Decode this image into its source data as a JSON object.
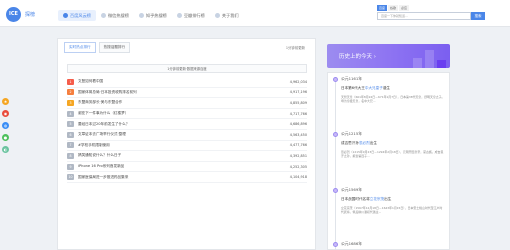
{
  "app": {
    "logo_text": "ICE",
    "title": "探榜"
  },
  "nav": [
    {
      "label": "百度风云榜",
      "active": true
    },
    {
      "label": "微信热搜榜",
      "active": false
    },
    {
      "label": "知乎热搜榜",
      "active": false
    },
    {
      "label": "豆瓣排行榜",
      "active": false
    },
    {
      "label": "关于我们",
      "active": false
    }
  ],
  "search": {
    "tabs": [
      "百度",
      "谷歌",
      "必应"
    ],
    "placeholder": "百度一下你就知道...",
    "button": "搜索"
  },
  "main": {
    "tabs": [
      {
        "label": "实时热点排行",
        "active": true
      },
      {
        "label": "热搜话题排行",
        "active": false
      }
    ],
    "updated": "1分钟前更新",
    "info": "1分钟前更新·数据来源百度",
    "rows": [
      {
        "rank": "1",
        "title": "文登如何看中国",
        "heat": "4,962,034",
        "color": "#f55d4b"
      },
      {
        "rank": "2",
        "title": "国家体育总局·日本投资收购排名前列",
        "heat": "4,917,196",
        "color": "#f57f3f"
      },
      {
        "rank": "3",
        "title": "东盟商务部长·美与东盟合作",
        "heat": "4,855,809",
        "color": "#f5a623"
      },
      {
        "rank": "4",
        "title": "谢亚下一件事为什么（红楼梦）",
        "heat": "4,717,766",
        "color": "#b0b8c4"
      },
      {
        "rank": "5",
        "title": "要经日本过20年前发生了什么？",
        "heat": "4,686,896",
        "color": "#b0b8c4"
      },
      {
        "rank": "6",
        "title": "文章证本去广场举行仪式·整理",
        "heat": "4,563,450",
        "color": "#b0b8c4"
      },
      {
        "rank": "7",
        "title": "#学校手机限制使用",
        "heat": "4,477,766",
        "color": "#b0b8c4"
      },
      {
        "rank": "8",
        "title": "搞笑通知说什么？什么日子",
        "heat": "4,392,851",
        "color": "#b0b8c4"
      },
      {
        "rank": "9",
        "title": "iPhone 16 Pro系列首发新品",
        "heat": "4,252,305",
        "color": "#b0b8c4"
      },
      {
        "rank": "10",
        "title": "国家医保局进一步推进药品集采",
        "heat": "4,104,918",
        "color": "#b0b8c4"
      }
    ]
  },
  "history": {
    "banner": "历史上的今天",
    "banner_arrow": "›",
    "entries": [
      {
        "year": "公元1161年",
        "title_prefix": "日本第6代大王",
        "title_highlight": "中大兄皇子",
        "title_suffix": "诞生",
        "text": "天智天皇（661年8月24日－671年1月7日），日本第38代天皇，舒明天皇之子。母为皇极天皇，名中大兄..."
      },
      {
        "year": "公元1215年",
        "title_prefix": "成吉思汗孙",
        "title_highlight": "忽必烈",
        "title_suffix": "出生",
        "text": "忽必烈（1215年9月23日－1294年2月18日），元朝开国皇帝，蒙古族。成吉思汗之孙，拖雷第四子..."
      },
      {
        "year": "公元1569年",
        "title_prefix": "日本战国时代名将",
        "title_highlight": "立花宗茂",
        "title_suffix": "出生",
        "text": "立花宗茂（1567年12月18日－1643年1月15日），日本安土桃山时代至江户时代武将，筑后柳川藩初代藩主..."
      },
      {
        "year": "公元1686年",
        "title_prefix": "",
        "title_highlight": "",
        "title_suffix": "",
        "text": ""
      }
    ]
  },
  "side_icons": [
    {
      "icon": "star-icon",
      "glyph": "★",
      "color": "#f5a623"
    },
    {
      "icon": "weibo-icon",
      "glyph": "◉",
      "color": "#e94b3c"
    },
    {
      "icon": "qq-icon",
      "glyph": "◍",
      "color": "#3a8ef6"
    },
    {
      "icon": "wechat-icon",
      "glyph": "●",
      "color": "#4cc05c"
    },
    {
      "icon": "share-icon",
      "glyph": "◐",
      "color": "#6bc4a0"
    }
  ]
}
